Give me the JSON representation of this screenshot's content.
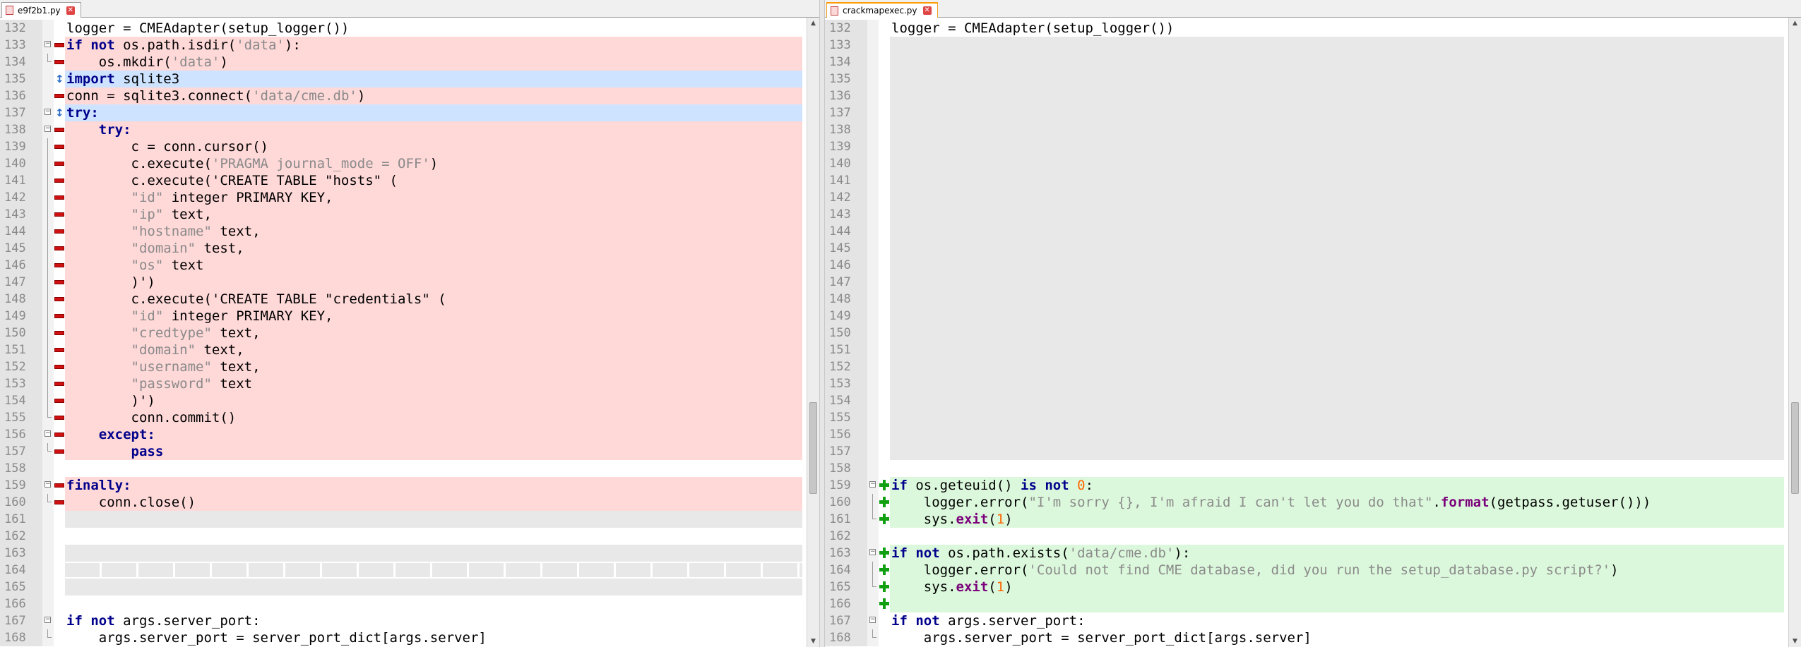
{
  "window": {
    "left_tab": {
      "label": "e9f2b1.py",
      "close": "✕"
    },
    "right_tab": {
      "label": "crackmapexec.py",
      "close": "✕"
    }
  },
  "colors": {
    "removed": "#ffd8d8",
    "added": "#dcf8dc",
    "changed": "#cde3ff",
    "empty": "#e8e8e8",
    "keyword": "#00008b",
    "string": "#8a8a8a",
    "number": "#ff6600"
  },
  "left_lines": [
    {
      "n": "132",
      "bg": "",
      "mark": "",
      "fold": "",
      "tokens": [
        [
          "",
          "logger = CMEAdapter(setup_logger())"
        ]
      ]
    },
    {
      "n": "133",
      "bg": "removed",
      "mark": "removed",
      "fold": "open",
      "tokens": [
        [
          "kw",
          "if not"
        ],
        [
          "",
          " os.path.isdir("
        ],
        [
          "str",
          "'data'"
        ],
        [
          "",
          "):"
        ]
      ]
    },
    {
      "n": "134",
      "bg": "removed",
      "mark": "removed",
      "fold": "end",
      "tokens": [
        [
          "",
          "    os.mkdir("
        ],
        [
          "str",
          "'data'"
        ],
        [
          "",
          ")"
        ]
      ]
    },
    {
      "n": "135",
      "bg": "changed",
      "mark": "changed",
      "fold": "",
      "tokens": [
        [
          "kw",
          "import"
        ],
        [
          "",
          " sqlite3"
        ]
      ]
    },
    {
      "n": "136",
      "bg": "removed",
      "mark": "removed",
      "fold": "",
      "tokens": [
        [
          "",
          "conn = sqlite3.connect("
        ],
        [
          "str",
          "'data/cme.db'"
        ],
        [
          "",
          ")"
        ]
      ]
    },
    {
      "n": "137",
      "bg": "changed",
      "mark": "changed",
      "fold": "open",
      "tokens": [
        [
          "kw",
          "try:"
        ]
      ]
    },
    {
      "n": "138",
      "bg": "removed",
      "mark": "removed",
      "fold": "open",
      "tokens": [
        [
          "",
          "    "
        ],
        [
          "kw",
          "try:"
        ]
      ]
    },
    {
      "n": "139",
      "bg": "removed",
      "mark": "removed",
      "fold": "line",
      "tokens": [
        [
          "",
          "        c = conn.cursor()"
        ]
      ]
    },
    {
      "n": "140",
      "bg": "removed",
      "mark": "removed",
      "fold": "line",
      "tokens": [
        [
          "",
          "        c.execute("
        ],
        [
          "str",
          "'PRAGMA journal_mode = OFF'"
        ],
        [
          "",
          ")"
        ]
      ]
    },
    {
      "n": "141",
      "bg": "removed",
      "mark": "removed",
      "fold": "line",
      "tokens": [
        [
          "",
          "        c.execute('CREATE TABLE \"hosts\" ("
        ]
      ]
    },
    {
      "n": "142",
      "bg": "removed",
      "mark": "removed",
      "fold": "line",
      "tokens": [
        [
          "",
          "        "
        ],
        [
          "str",
          "\"id\""
        ],
        [
          "",
          " integer PRIMARY KEY,"
        ]
      ]
    },
    {
      "n": "143",
      "bg": "removed",
      "mark": "removed",
      "fold": "line",
      "tokens": [
        [
          "",
          "        "
        ],
        [
          "str",
          "\"ip\""
        ],
        [
          "",
          " text,"
        ]
      ]
    },
    {
      "n": "144",
      "bg": "removed",
      "mark": "removed",
      "fold": "line",
      "tokens": [
        [
          "",
          "        "
        ],
        [
          "str",
          "\"hostname\""
        ],
        [
          "",
          " text,"
        ]
      ]
    },
    {
      "n": "145",
      "bg": "removed",
      "mark": "removed",
      "fold": "line",
      "tokens": [
        [
          "",
          "        "
        ],
        [
          "str",
          "\"domain\""
        ],
        [
          "",
          " test,"
        ]
      ]
    },
    {
      "n": "146",
      "bg": "removed",
      "mark": "removed",
      "fold": "line",
      "tokens": [
        [
          "",
          "        "
        ],
        [
          "str",
          "\"os\""
        ],
        [
          "",
          " text"
        ]
      ]
    },
    {
      "n": "147",
      "bg": "removed",
      "mark": "removed",
      "fold": "line",
      "tokens": [
        [
          "",
          "        )')"
        ]
      ]
    },
    {
      "n": "148",
      "bg": "removed",
      "mark": "removed",
      "fold": "line",
      "tokens": [
        [
          "",
          "        c.execute('CREATE TABLE \"credentials\" ("
        ]
      ]
    },
    {
      "n": "149",
      "bg": "removed",
      "mark": "removed",
      "fold": "line",
      "tokens": [
        [
          "",
          "        "
        ],
        [
          "str",
          "\"id\""
        ],
        [
          "",
          " integer PRIMARY KEY,"
        ]
      ]
    },
    {
      "n": "150",
      "bg": "removed",
      "mark": "removed",
      "fold": "line",
      "tokens": [
        [
          "",
          "        "
        ],
        [
          "str",
          "\"credtype\""
        ],
        [
          "",
          " text,"
        ]
      ]
    },
    {
      "n": "151",
      "bg": "removed",
      "mark": "removed",
      "fold": "line",
      "tokens": [
        [
          "",
          "        "
        ],
        [
          "str",
          "\"domain\""
        ],
        [
          "",
          " text,"
        ]
      ]
    },
    {
      "n": "152",
      "bg": "removed",
      "mark": "removed",
      "fold": "line",
      "tokens": [
        [
          "",
          "        "
        ],
        [
          "str",
          "\"username\""
        ],
        [
          "",
          " text,"
        ]
      ]
    },
    {
      "n": "153",
      "bg": "removed",
      "mark": "removed",
      "fold": "line",
      "tokens": [
        [
          "",
          "        "
        ],
        [
          "str",
          "\"password\""
        ],
        [
          "",
          " text"
        ]
      ]
    },
    {
      "n": "154",
      "bg": "removed",
      "mark": "removed",
      "fold": "line",
      "tokens": [
        [
          "",
          "        )')"
        ]
      ]
    },
    {
      "n": "155",
      "bg": "removed",
      "mark": "removed",
      "fold": "end",
      "tokens": [
        [
          "",
          "        conn.commit()"
        ]
      ]
    },
    {
      "n": "156",
      "bg": "removed",
      "mark": "removed",
      "fold": "open",
      "tokens": [
        [
          "",
          "    "
        ],
        [
          "kw",
          "except:"
        ]
      ]
    },
    {
      "n": "157",
      "bg": "removed",
      "mark": "removed",
      "fold": "end",
      "tokens": [
        [
          "",
          "        "
        ],
        [
          "kw",
          "pass"
        ]
      ]
    },
    {
      "n": "158",
      "bg": "",
      "mark": "",
      "fold": "",
      "tokens": [
        [
          "",
          ""
        ]
      ]
    },
    {
      "n": "159",
      "bg": "removed",
      "mark": "removed",
      "fold": "open",
      "tokens": [
        [
          "kw",
          "finally:"
        ]
      ]
    },
    {
      "n": "160",
      "bg": "removed",
      "mark": "removed",
      "fold": "end",
      "tokens": [
        [
          "",
          "    conn.close()"
        ]
      ]
    },
    {
      "n": "161",
      "bg": "empty",
      "mark": "",
      "fold": "",
      "tokens": [
        [
          "",
          ""
        ]
      ]
    },
    {
      "n": "162",
      "bg": "",
      "mark": "",
      "fold": "",
      "tokens": [
        [
          "",
          ""
        ]
      ]
    },
    {
      "n": "163",
      "bg": "empty",
      "mark": "",
      "fold": "",
      "tokens": [
        [
          "",
          ""
        ]
      ]
    },
    {
      "n": "164",
      "bg": "dashed",
      "mark": "",
      "fold": "",
      "tokens": [
        [
          "",
          ""
        ]
      ]
    },
    {
      "n": "165",
      "bg": "empty",
      "mark": "",
      "fold": "",
      "tokens": [
        [
          "",
          ""
        ]
      ]
    },
    {
      "n": "166",
      "bg": "",
      "mark": "",
      "fold": "",
      "tokens": [
        [
          "",
          ""
        ]
      ]
    },
    {
      "n": "167",
      "bg": "",
      "mark": "",
      "fold": "open",
      "tokens": [
        [
          "kw",
          "if not"
        ],
        [
          "",
          " args.server_port:"
        ]
      ]
    },
    {
      "n": "168",
      "bg": "",
      "mark": "",
      "fold": "end",
      "tokens": [
        [
          "",
          "    args.server_port = server_port_dict[args.server]"
        ]
      ]
    }
  ],
  "right_lines": [
    {
      "n": "132",
      "bg": "",
      "mark": "",
      "fold": "",
      "tokens": [
        [
          "",
          "logger = CMEAdapter(setup_logger())"
        ]
      ]
    },
    {
      "n": "133",
      "bg": "placeholder",
      "mark": "",
      "fold": "",
      "tokens": [
        [
          "",
          ""
        ]
      ]
    },
    {
      "n": "134",
      "bg": "placeholder",
      "mark": "",
      "fold": "",
      "tokens": [
        [
          "",
          ""
        ]
      ]
    },
    {
      "n": "135",
      "bg": "placeholder",
      "mark": "",
      "fold": "",
      "tokens": [
        [
          "",
          ""
        ]
      ]
    },
    {
      "n": "136",
      "bg": "placeholder",
      "mark": "",
      "fold": "",
      "tokens": [
        [
          "",
          ""
        ]
      ]
    },
    {
      "n": "137",
      "bg": "placeholder",
      "mark": "",
      "fold": "",
      "tokens": [
        [
          "",
          ""
        ]
      ]
    },
    {
      "n": "138",
      "bg": "placeholder",
      "mark": "",
      "fold": "",
      "tokens": [
        [
          "",
          ""
        ]
      ]
    },
    {
      "n": "139",
      "bg": "placeholder",
      "mark": "",
      "fold": "",
      "tokens": [
        [
          "",
          ""
        ]
      ]
    },
    {
      "n": "140",
      "bg": "placeholder",
      "mark": "",
      "fold": "",
      "tokens": [
        [
          "",
          ""
        ]
      ]
    },
    {
      "n": "141",
      "bg": "placeholder",
      "mark": "",
      "fold": "",
      "tokens": [
        [
          "",
          ""
        ]
      ]
    },
    {
      "n": "142",
      "bg": "placeholder",
      "mark": "",
      "fold": "",
      "tokens": [
        [
          "",
          ""
        ]
      ]
    },
    {
      "n": "143",
      "bg": "placeholder",
      "mark": "",
      "fold": "",
      "tokens": [
        [
          "",
          ""
        ]
      ]
    },
    {
      "n": "144",
      "bg": "placeholder",
      "mark": "",
      "fold": "",
      "tokens": [
        [
          "",
          ""
        ]
      ]
    },
    {
      "n": "145",
      "bg": "placeholder",
      "mark": "",
      "fold": "",
      "tokens": [
        [
          "",
          ""
        ]
      ]
    },
    {
      "n": "146",
      "bg": "placeholder",
      "mark": "",
      "fold": "",
      "tokens": [
        [
          "",
          ""
        ]
      ]
    },
    {
      "n": "147",
      "bg": "placeholder",
      "mark": "",
      "fold": "",
      "tokens": [
        [
          "",
          ""
        ]
      ]
    },
    {
      "n": "148",
      "bg": "placeholder",
      "mark": "",
      "fold": "",
      "tokens": [
        [
          "",
          ""
        ]
      ]
    },
    {
      "n": "149",
      "bg": "placeholder",
      "mark": "",
      "fold": "",
      "tokens": [
        [
          "",
          ""
        ]
      ]
    },
    {
      "n": "150",
      "bg": "placeholder",
      "mark": "",
      "fold": "",
      "tokens": [
        [
          "",
          ""
        ]
      ]
    },
    {
      "n": "151",
      "bg": "placeholder",
      "mark": "",
      "fold": "",
      "tokens": [
        [
          "",
          ""
        ]
      ]
    },
    {
      "n": "152",
      "bg": "placeholder",
      "mark": "",
      "fold": "",
      "tokens": [
        [
          "",
          ""
        ]
      ]
    },
    {
      "n": "153",
      "bg": "placeholder",
      "mark": "",
      "fold": "",
      "tokens": [
        [
          "",
          ""
        ]
      ]
    },
    {
      "n": "154",
      "bg": "placeholder",
      "mark": "",
      "fold": "",
      "tokens": [
        [
          "",
          ""
        ]
      ]
    },
    {
      "n": "155",
      "bg": "placeholder",
      "mark": "",
      "fold": "",
      "tokens": [
        [
          "",
          ""
        ]
      ]
    },
    {
      "n": "156",
      "bg": "placeholder",
      "mark": "",
      "fold": "",
      "tokens": [
        [
          "",
          ""
        ]
      ]
    },
    {
      "n": "157",
      "bg": "placeholder",
      "mark": "",
      "fold": "",
      "tokens": [
        [
          "",
          ""
        ]
      ]
    },
    {
      "n": "158",
      "bg": "",
      "mark": "",
      "fold": "",
      "tokens": [
        [
          "",
          ""
        ]
      ]
    },
    {
      "n": "159",
      "bg": "added",
      "mark": "added",
      "fold": "open",
      "tokens": [
        [
          "kw",
          "if"
        ],
        [
          "",
          " os.geteuid() "
        ],
        [
          "kw",
          "is not"
        ],
        [
          "",
          " "
        ],
        [
          "num",
          "0"
        ],
        [
          "",
          ":"
        ]
      ]
    },
    {
      "n": "160",
      "bg": "added",
      "mark": "added",
      "fold": "line",
      "tokens": [
        [
          "",
          "    logger.error("
        ],
        [
          "str",
          "\"I'm sorry {}, I'm afraid I can't let you do that\""
        ],
        [
          "",
          "."
        ],
        [
          "kw2",
          "format"
        ],
        [
          "",
          "(getpass.getuser())"
        ],
        [
          "",
          ")"
        ]
      ]
    },
    {
      "n": "161",
      "bg": "added",
      "mark": "added",
      "fold": "end",
      "tokens": [
        [
          "",
          "    sys."
        ],
        [
          "kw2",
          "exit"
        ],
        [
          "",
          "("
        ],
        [
          "num",
          "1"
        ],
        [
          "",
          ")"
        ]
      ]
    },
    {
      "n": "162",
      "bg": "",
      "mark": "",
      "fold": "",
      "tokens": [
        [
          "",
          ""
        ]
      ]
    },
    {
      "n": "163",
      "bg": "added",
      "mark": "added",
      "fold": "open",
      "tokens": [
        [
          "kw",
          "if not"
        ],
        [
          "",
          " os.path.exists("
        ],
        [
          "str",
          "'data/cme.db'"
        ],
        [
          "",
          "):"
        ]
      ]
    },
    {
      "n": "164",
      "bg": "added",
      "mark": "added",
      "fold": "line",
      "tokens": [
        [
          "",
          "    logger.error("
        ],
        [
          "str",
          "'Could not find CME database, did you run the setup_database.py script?'"
        ],
        [
          "",
          ")"
        ]
      ]
    },
    {
      "n": "165",
      "bg": "added",
      "mark": "added",
      "fold": "end",
      "tokens": [
        [
          "",
          "    sys."
        ],
        [
          "kw2",
          "exit"
        ],
        [
          "",
          "("
        ],
        [
          "num",
          "1"
        ],
        [
          "",
          ")"
        ]
      ]
    },
    {
      "n": "166",
      "bg": "added",
      "mark": "added",
      "fold": "",
      "tokens": [
        [
          "",
          ""
        ]
      ]
    },
    {
      "n": "167",
      "bg": "",
      "mark": "",
      "fold": "open",
      "tokens": [
        [
          "kw",
          "if not"
        ],
        [
          "",
          " args.server_port:"
        ]
      ]
    },
    {
      "n": "168",
      "bg": "",
      "mark": "",
      "fold": "end",
      "tokens": [
        [
          "",
          "    args.server_port = server_port_dict[args.server]"
        ]
      ]
    }
  ],
  "scrollbar": {
    "up": "▲",
    "down": "▼"
  }
}
